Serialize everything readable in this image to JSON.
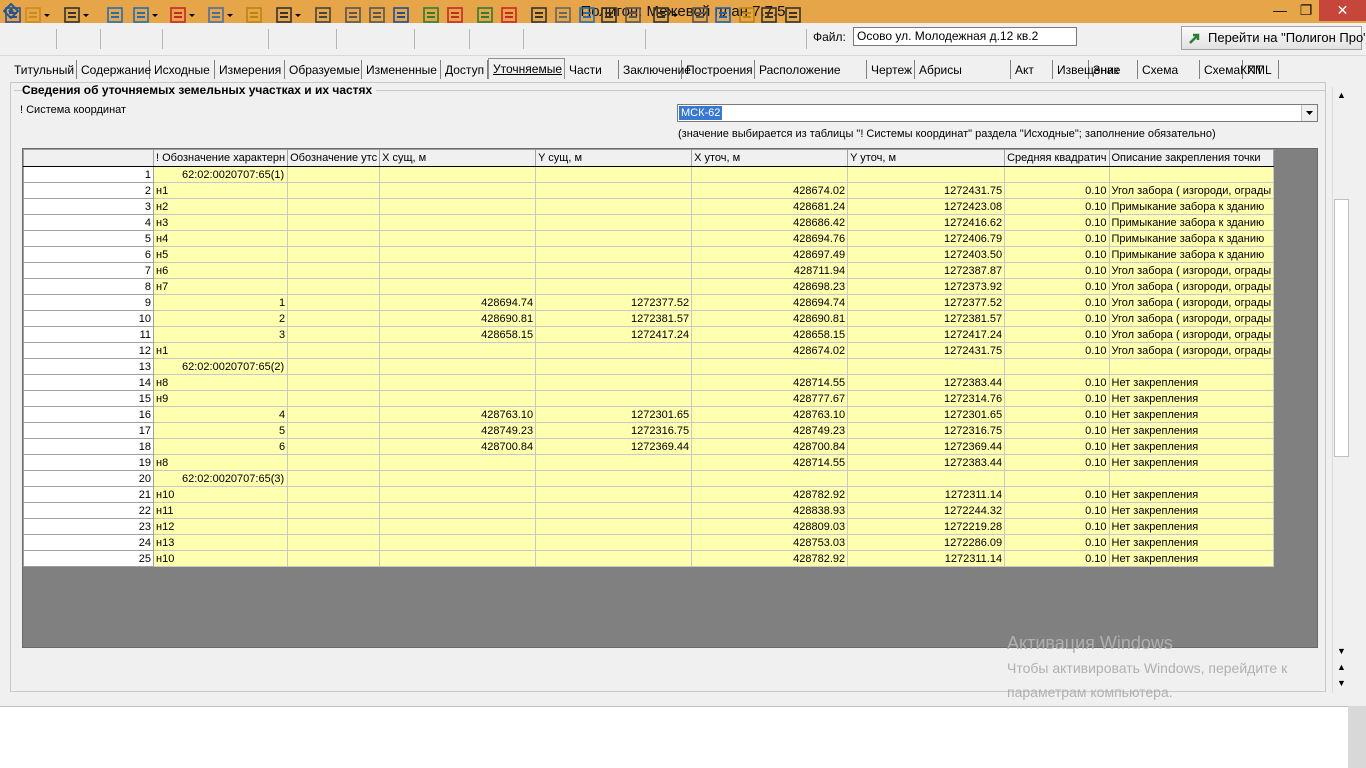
{
  "window": {
    "title": "Полигон: Межевой план 7.7.5",
    "min_glyph": "—",
    "max_glyph": "❐",
    "close_glyph": "✕"
  },
  "toolbar": {
    "icons": [
      "new-doc-icon",
      "open-folder-icon",
      "save-icon",
      "export-xml-icon",
      "import-xml-icon",
      "sign-icon",
      "zip-icon",
      "transfer-icon",
      "print-icon",
      "preview-icon",
      "copy-icon",
      "paste-icon",
      "undo-icon",
      "add-row-icon",
      "delete-row-icon",
      "add-point-icon",
      "delete-point-icon",
      "pencil-icon",
      "copy-table-icon",
      "xml-check-icon",
      "spell-check-icon",
      "edit-doc-icon",
      "search-icon",
      "envelope-icon",
      "refresh-icon",
      "help-icon",
      "whats-this-icon",
      "pointer-icon"
    ],
    "file_label": "Файл:",
    "file_value": "Осово ул. Молодежная д.12 кв.2",
    "goto_label": "Перейти на \"Полигон Про\""
  },
  "tabs": [
    "Титульный",
    "Содержание",
    "Исходные",
    "Измерения",
    "Образуемые",
    "Измененные",
    "Доступ",
    "Уточняемые",
    "Части",
    "Заключение",
    "Построения",
    "Расположение",
    "Чертеж",
    "Абрисы",
    "Акт",
    "Извещение",
    "Знак",
    "Схема",
    "СхемаКПТ",
    "XML"
  ],
  "active_tab": "Уточняемые",
  "section": {
    "title": "Сведения об уточняемых земельных участках и их частях",
    "coord_label": "! Система координат",
    "coord_value": "МСК-62",
    "coord_hint": "(значение выбирается из таблицы \"! Системы координат\" раздела \"Исходные\"; заполнение обязательно)"
  },
  "grid": {
    "columns": [
      "",
      "! Обозначение характерн",
      "Обозначение утс",
      "X сущ, м",
      "Y сущ, м",
      "X уточ, м",
      "Y уточ, м",
      "Средняя квадратич",
      "Описание закрепления точки"
    ],
    "rows": [
      [
        "1",
        "62:02:0020707:65(1)",
        "",
        "",
        "",
        "",
        "",
        "",
        ""
      ],
      [
        "2",
        "н1",
        "",
        "",
        "",
        "428674.02",
        "1272431.75",
        "0.10",
        "Угол забора ( изгороди, ограды"
      ],
      [
        "3",
        "н2",
        "",
        "",
        "",
        "428681.24",
        "1272423.08",
        "0.10",
        "Примыкание забора к зданию"
      ],
      [
        "4",
        "н3",
        "",
        "",
        "",
        "428686.42",
        "1272416.62",
        "0.10",
        "Примыкание забора к зданию"
      ],
      [
        "5",
        "н4",
        "",
        "",
        "",
        "428694.76",
        "1272406.79",
        "0.10",
        "Примыкание забора к зданию"
      ],
      [
        "6",
        "н5",
        "",
        "",
        "",
        "428697.49",
        "1272403.50",
        "0.10",
        "Примыкание забора к зданию"
      ],
      [
        "7",
        "н6",
        "",
        "",
        "",
        "428711.94",
        "1272387.87",
        "0.10",
        "Угол забора ( изгороди, ограды"
      ],
      [
        "8",
        "н7",
        "",
        "",
        "",
        "428698.23",
        "1272373.92",
        "0.10",
        "Угол забора ( изгороди, ограды"
      ],
      [
        "9",
        "1",
        "",
        "428694.74",
        "1272377.52",
        "428694.74",
        "1272377.52",
        "0.10",
        "Угол забора ( изгороди, ограды"
      ],
      [
        "10",
        "2",
        "",
        "428690.81",
        "1272381.57",
        "428690.81",
        "1272381.57",
        "0.10",
        "Угол забора ( изгороди, ограды"
      ],
      [
        "11",
        "3",
        "",
        "428658.15",
        "1272417.24",
        "428658.15",
        "1272417.24",
        "0.10",
        "Угол забора ( изгороди, ограды"
      ],
      [
        "12",
        "н1",
        "",
        "",
        "",
        "428674.02",
        "1272431.75",
        "0.10",
        "Угол забора ( изгороди, ограды"
      ],
      [
        "13",
        "62:02:0020707:65(2)",
        "",
        "",
        "",
        "",
        "",
        "",
        ""
      ],
      [
        "14",
        "н8",
        "",
        "",
        "",
        "428714.55",
        "1272383.44",
        "0.10",
        "Нет закрепления"
      ],
      [
        "15",
        "н9",
        "",
        "",
        "",
        "428777.67",
        "1272314.76",
        "0.10",
        "Нет закрепления"
      ],
      [
        "16",
        "4",
        "",
        "428763.10",
        "1272301.65",
        "428763.10",
        "1272301.65",
        "0.10",
        "Нет закрепления"
      ],
      [
        "17",
        "5",
        "",
        "428749.23",
        "1272316.75",
        "428749.23",
        "1272316.75",
        "0.10",
        "Нет закрепления"
      ],
      [
        "18",
        "6",
        "",
        "428700.84",
        "1272369.44",
        "428700.84",
        "1272369.44",
        "0.10",
        "Нет закрепления"
      ],
      [
        "19",
        "н8",
        "",
        "",
        "",
        "428714.55",
        "1272383.44",
        "0.10",
        "Нет закрепления"
      ],
      [
        "20",
        "62:02:0020707:65(3)",
        "",
        "",
        "",
        "",
        "",
        "",
        ""
      ],
      [
        "21",
        "н10",
        "",
        "",
        "",
        "428782.92",
        "1272311.14",
        "0.10",
        "Нет закрепления"
      ],
      [
        "22",
        "н11",
        "",
        "",
        "",
        "428838.93",
        "1272244.32",
        "0.10",
        "Нет закрепления"
      ],
      [
        "23",
        "н12",
        "",
        "",
        "",
        "428809.03",
        "1272219.28",
        "0.10",
        "Нет закрепления"
      ],
      [
        "24",
        "н13",
        "",
        "",
        "",
        "428753.03",
        "1272286.09",
        "0.10",
        "Нет закрепления"
      ],
      [
        "25",
        "н10",
        "",
        "",
        "",
        "428782.92",
        "1272311.14",
        "0.10",
        "Нет закрепления"
      ]
    ]
  },
  "scrollbar": {
    "up": "▲",
    "down": "▼"
  },
  "watermark": {
    "line1": "Активация Windows",
    "line2": "Чтобы активировать Windows, перейдите к",
    "line3": "параметрам компьютера."
  }
}
